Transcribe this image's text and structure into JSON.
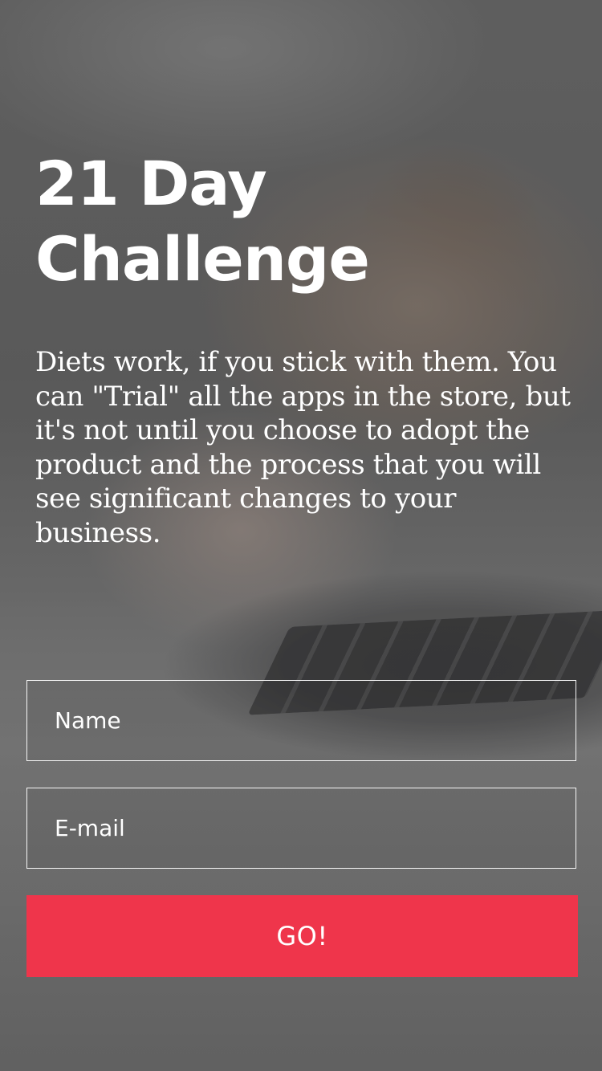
{
  "hero": {
    "title_line1": "21 Day",
    "title_line2": "Challenge",
    "description": "Diets work, if you stick with them. You can \"Trial\" all the apps in the store, but it's not until you choose to adopt the product and the process that you will see significant changes to your business."
  },
  "form": {
    "name_placeholder": "Name",
    "email_placeholder": "E-mail",
    "submit_label": "GO!"
  },
  "colors": {
    "accent": "#ef354b",
    "text": "#ffffff"
  }
}
